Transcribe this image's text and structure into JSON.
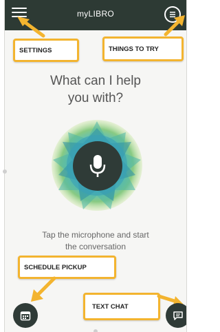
{
  "header": {
    "app_title": "myLIBRO",
    "menu_icon": "hamburger-icon",
    "things_icon": "list-circle-icon"
  },
  "main": {
    "headline_line1": "What can I help",
    "headline_line2": "you with?",
    "instruction_line1": "Tap the microphone and start",
    "instruction_line2": "the conversation",
    "mic_icon": "microphone-icon"
  },
  "callouts": {
    "settings": "SETTINGS",
    "things_to_try": "THINGS TO TRY",
    "schedule_pickup": "SCHEDULE PICKUP",
    "text_chat": "TEXT CHAT"
  },
  "bottom": {
    "calendar_icon": "calendar-icon",
    "chat_icon": "chat-bubble-icon"
  },
  "colors": {
    "topbar": "#2d3a34",
    "callout_border": "#f3b42f",
    "button": "#2f3b37",
    "orb_accent": "#3fb6c8",
    "orb_green": "#7cc576"
  }
}
